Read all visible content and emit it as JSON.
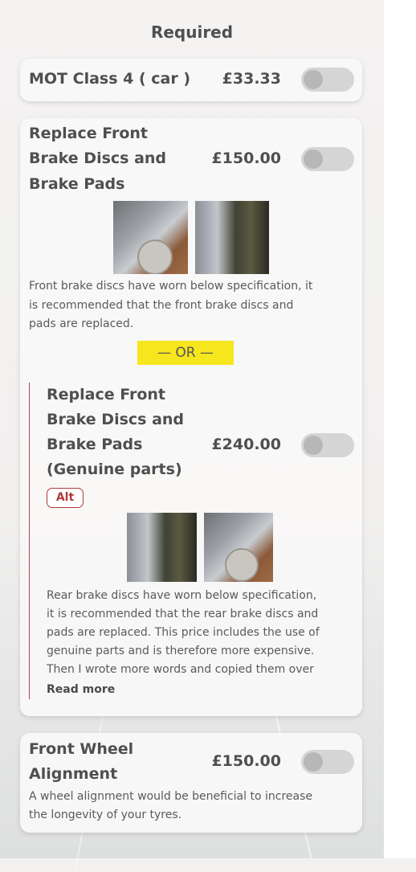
{
  "section_heading": "Required",
  "items": [
    {
      "title_lines": [
        "MOT Class 4 ( car )"
      ],
      "price": "£33.33"
    },
    {
      "title_lines": [
        "Replace Front",
        "Brake Discs and",
        "Brake Pads"
      ],
      "price": "£150.00",
      "images": [
        "brake-disc-photo",
        "brake-pad-photo"
      ],
      "description_lines": [
        "Front brake discs have worn below specification, it",
        "is recommended that the front brake discs and",
        "pads are replaced."
      ],
      "alternative": {
        "separator": "— OR —",
        "title_lines": [
          "Replace Front",
          "Brake Discs and",
          "Brake Pads",
          "(Genuine parts)"
        ],
        "price": "£240.00",
        "badge": "Alt",
        "images": [
          "brake-pad-photo",
          "brake-disc-photo"
        ],
        "description_lines": [
          "Rear brake discs have worn below specification,",
          "it is recommended that the rear brake discs and",
          "pads are replaced. This price includes the use of",
          "genuine parts and is therefore more expensive.",
          "Then I wrote more words and copied them over"
        ],
        "read_more": "Read more"
      }
    },
    {
      "title_lines": [
        "Front Wheel",
        "Alignment"
      ],
      "price": "£150.00",
      "description_lines": [
        "A wheel alignment would be beneficial to increase",
        "the longevity of your tyres."
      ]
    }
  ],
  "colors": {
    "or_highlight": "#f6e61d",
    "alt_accent": "#b03a3a",
    "toggle_off": "#d5d5d5"
  }
}
